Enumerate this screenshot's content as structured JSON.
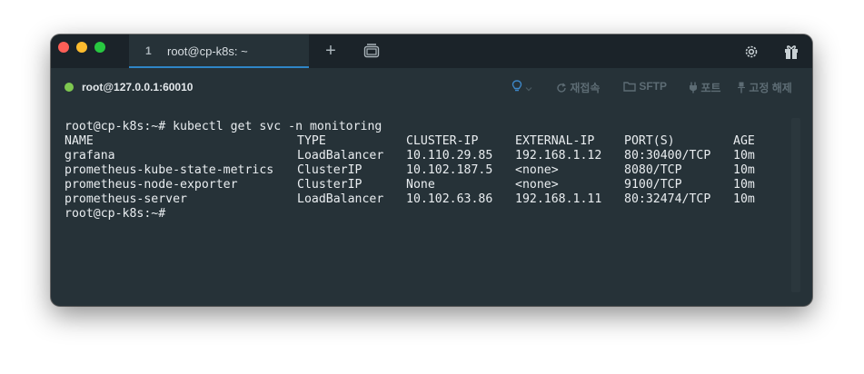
{
  "window": {
    "tab": {
      "number": "1",
      "title": "root@cp-k8s: ~"
    },
    "new_tab_symbol": "+"
  },
  "infobar": {
    "host": "root@127.0.0.1:60010",
    "tools": {
      "hint_icon": "lightbulb-icon",
      "reconnect": "재접속",
      "sftp": "SFTP",
      "port": "포트",
      "pin": "고정 해제"
    }
  },
  "terminal": {
    "command_line": "root@cp-k8s:~# kubectl get svc -n monitoring",
    "headers": [
      "NAME",
      "TYPE",
      "CLUSTER-IP",
      "EXTERNAL-IP",
      "PORT(S)",
      "AGE"
    ],
    "rows": [
      [
        "grafana",
        "LoadBalancer",
        "10.110.29.85",
        "192.168.1.12",
        "80:30400/TCP",
        "10m"
      ],
      [
        "prometheus-kube-state-metrics",
        "ClusterIP",
        "10.102.187.5",
        "<none>",
        "8080/TCP",
        "10m"
      ],
      [
        "prometheus-node-exporter",
        "ClusterIP",
        "None",
        "<none>",
        "9100/TCP",
        "10m"
      ],
      [
        "prometheus-server",
        "LoadBalancer",
        "10.102.63.86",
        "192.168.1.11",
        "80:32474/TCP",
        "10m"
      ]
    ],
    "prompt": "root@cp-k8s:~#"
  },
  "colors": {
    "terminal_bg": "#263238",
    "titlebar_bg": "#1b2329",
    "tab_accent": "#2f86c7",
    "status_green": "#7ec850"
  }
}
